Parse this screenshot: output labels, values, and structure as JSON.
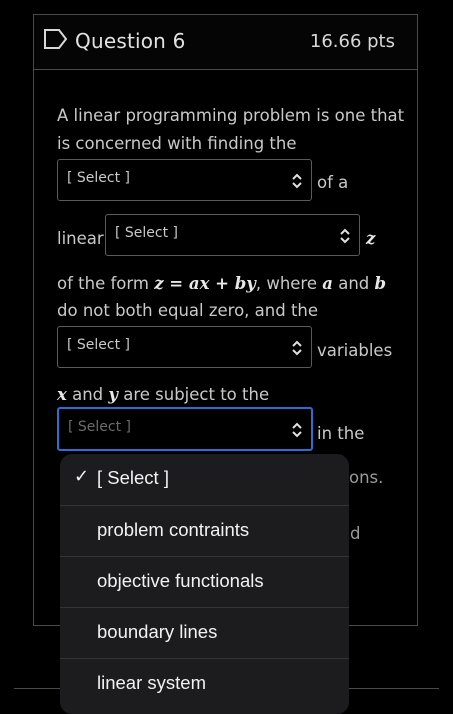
{
  "question": {
    "title": "Question 6",
    "points": "16.66 pts"
  },
  "body": {
    "line1": "A linear programming problem is one that",
    "line2": "is concerned with finding the",
    "after_select1": "of a",
    "linear_word": "linear",
    "z_var": "z",
    "line_form": "of the form ",
    "form_eq": "z = ax + by",
    "form_tail": ", where ",
    "a_var": "a",
    "and_word": " and ",
    "b_var": "b",
    "line_both": "do not both equal zero, and the",
    "after_select3": "variables",
    "x_var": "x",
    "and_word2": " and ",
    "y_var": "y",
    "subject_tail": " are subject to the",
    "after_select4": "in the",
    "partial_ons": "ons.",
    "partial_d": "d"
  },
  "selects": {
    "select1": "[ Select ]",
    "select2": "[ Select ]",
    "select3": "[ Select ]",
    "select4": "[ Select ]"
  },
  "dropdown": {
    "options": [
      {
        "label": "[ Select ]",
        "selected": true
      },
      {
        "label": "problem contraints",
        "selected": false
      },
      {
        "label": "objective functionals",
        "selected": false
      },
      {
        "label": "boundary lines",
        "selected": false
      },
      {
        "label": "linear system",
        "selected": false
      }
    ]
  },
  "colors": {
    "background": "#000000",
    "focus_border": "#2a6fd6",
    "dropdown_bg": "#1c1c1e"
  }
}
